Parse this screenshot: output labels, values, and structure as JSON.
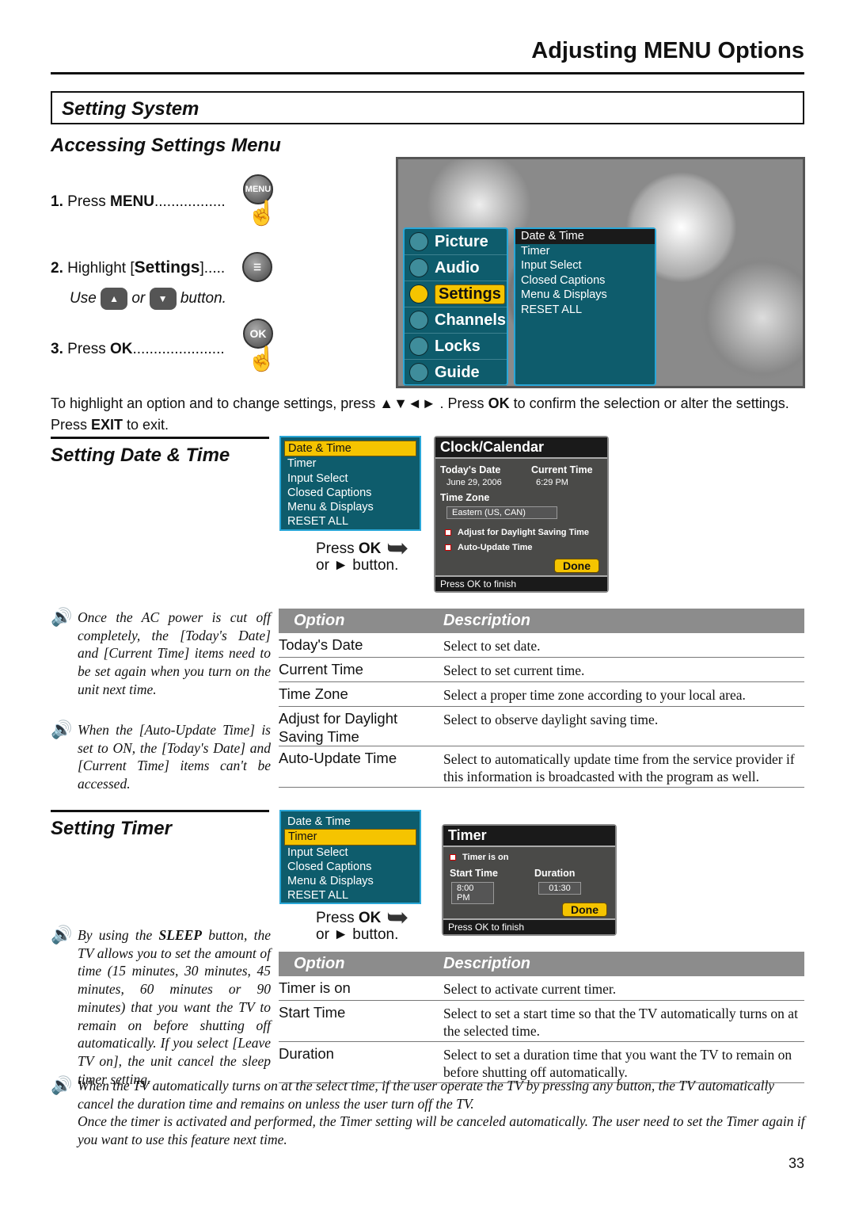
{
  "header": {
    "title": "Adjusting MENU Options"
  },
  "section": {
    "title": "Setting System"
  },
  "accessing": {
    "title": "Accessing Settings Menu",
    "step1": {
      "num": "1.",
      "pre": "Press ",
      "key": "MENU",
      "dots": ".................",
      "icon": "MENU"
    },
    "step2": {
      "num": "2.",
      "pre": "Highlight [",
      "key": "Settings",
      "post": "].....",
      "use": "Use",
      "or": "or",
      "button": "button."
    },
    "step3": {
      "num": "3.",
      "pre": "Press ",
      "key": "OK",
      "dots": "......................",
      "icon": "OK"
    }
  },
  "tv_menu": {
    "main": [
      {
        "label": "Picture",
        "icon": "picture-icon"
      },
      {
        "label": "Audio",
        "icon": "audio-icon"
      },
      {
        "label": "Settings",
        "icon": "settings-icon",
        "selected": true
      },
      {
        "label": "Channels",
        "icon": "channels-icon"
      },
      {
        "label": "Locks",
        "icon": "lock-icon"
      },
      {
        "label": "Guide",
        "icon": "guide-icon"
      }
    ],
    "sub": [
      "Date & Time",
      "Timer",
      "Input Select",
      "Closed Captions",
      "Menu & Displays",
      "RESET ALL"
    ],
    "sub_highlight": 0
  },
  "instructions": {
    "line1_a": "To highlight an option and to change settings, press ▲▼◄► . Press ",
    "ok": "OK",
    "line1_b": " to confirm the selection or alter the settings.",
    "line2_a": "Press ",
    "exit": "EXIT",
    "line2_b": " to exit."
  },
  "date_time": {
    "title": "Setting Date & Time",
    "submenu": [
      "Date & Time",
      "Timer",
      "Input Select",
      "Closed Captions",
      "Menu & Displays",
      "RESET ALL"
    ],
    "submenu_highlight": 0,
    "press_ok": "Press ",
    "ok": "OK",
    "or_line": "or ► button.",
    "panel": {
      "title": "Clock/Calendar",
      "todays_date_label": "Today's Date",
      "todays_date": "June 29, 2006",
      "current_time_label": "Current Time",
      "current_time": "6:29 PM",
      "time_zone_label": "Time Zone",
      "time_zone": "Eastern (US, CAN)",
      "dst_label": "Adjust for Daylight Saving Time",
      "dst_checked": true,
      "auto_label": "Auto-Update Time",
      "auto_checked": true,
      "done": "Done",
      "footer": "Press OK to finish"
    },
    "notes": [
      "Once the AC power is cut off completely, the [Today's Date] and [Current Time] items need to be set again when you turn on the unit next time.",
      "When the [Auto-Update Time] is set to ON, the [Today's Date] and [Current Time] items can't be accessed."
    ],
    "table": {
      "headers": [
        "Option",
        "Description"
      ],
      "rows": [
        [
          "Today's Date",
          "Select to set date."
        ],
        [
          "Current Time",
          "Select to set current time."
        ],
        [
          "Time Zone",
          "Select a proper time zone according to your local area."
        ],
        [
          "Adjust for Daylight Saving Time",
          "Select to observe daylight saving time."
        ],
        [
          "Auto-Update Time",
          "Select to automatically update time from the service provider if this information is broadcasted with the program as well."
        ]
      ]
    }
  },
  "timer": {
    "title": "Setting Timer",
    "submenu": [
      "Date & Time",
      "Timer",
      "Input Select",
      "Closed Captions",
      "Menu & Displays",
      "RESET ALL"
    ],
    "submenu_highlight": 1,
    "press_ok": "Press ",
    "ok": "OK",
    "or_line": "or ► button.",
    "panel": {
      "title": "Timer",
      "timer_on_label": "Timer is on",
      "timer_on_checked": true,
      "start_label": "Start Time",
      "start": "8:00 PM",
      "duration_label": "Duration",
      "duration": "01:30",
      "done": "Done",
      "footer": "Press OK to finish"
    },
    "note_a": "By using the ",
    "note_key": "SLEEP",
    "note_b": " button, the TV allows you to set the amount of time (15 minutes, 30 minutes, 45 minutes, 60 minutes or 90 minutes) that you want the TV to remain on before shutting off automatically. If you select [Leave TV on], the unit cancel the sleep timer setting.",
    "table": {
      "headers": [
        "Option",
        "Description"
      ],
      "rows": [
        [
          "Timer is on",
          "Select to activate current timer."
        ],
        [
          "Start Time",
          "Select to set a start time so that the TV automatically turns on at the selected time."
        ],
        [
          "Duration",
          "Select to set a duration time that you want the TV to remain on before shutting off automatically."
        ]
      ]
    },
    "bottom_note_1": "When the TV automatically turns on at the select time, if the user operate the TV by pressing any button, the TV automatically cancel the duration time and remains on unless the user turn off the TV.",
    "bottom_note_2": "Once the timer is activated and performed, the Timer setting will be canceled automatically. The user need to set the Timer again if you want to use this feature next time."
  },
  "page_number": "33"
}
